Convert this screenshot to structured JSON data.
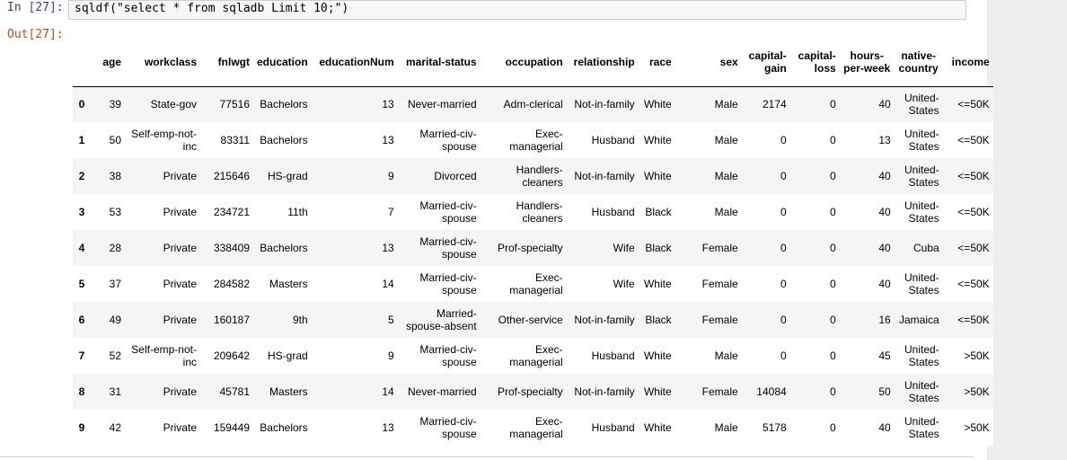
{
  "cell": {
    "in_prompt": "In [27]:",
    "code": "sqldf(\"select * from sqladb Limit 10;\")",
    "out_prompt": "Out[27]:"
  },
  "table": {
    "columns": [
      "",
      "age",
      "workclass",
      "fnlwgt",
      "education",
      "educationNum",
      "marital-status",
      "occupation",
      "relationship",
      "race",
      "sex",
      "capital-gain",
      "capital-loss",
      "hours-per-week",
      "native-country",
      "income"
    ],
    "rows": [
      [
        "0",
        "39",
        "State-gov",
        "77516",
        "Bachelors",
        "13",
        "Never-married",
        "Adm-clerical",
        "Not-in-family",
        "White",
        "Male",
        "2174",
        "0",
        "40",
        "United-States",
        "<=50K"
      ],
      [
        "1",
        "50",
        "Self-emp-not-inc",
        "83311",
        "Bachelors",
        "13",
        "Married-civ-spouse",
        "Exec-managerial",
        "Husband",
        "White",
        "Male",
        "0",
        "0",
        "13",
        "United-States",
        "<=50K"
      ],
      [
        "2",
        "38",
        "Private",
        "215646",
        "HS-grad",
        "9",
        "Divorced",
        "Handlers-cleaners",
        "Not-in-family",
        "White",
        "Male",
        "0",
        "0",
        "40",
        "United-States",
        "<=50K"
      ],
      [
        "3",
        "53",
        "Private",
        "234721",
        "11th",
        "7",
        "Married-civ-spouse",
        "Handlers-cleaners",
        "Husband",
        "Black",
        "Male",
        "0",
        "0",
        "40",
        "United-States",
        "<=50K"
      ],
      [
        "4",
        "28",
        "Private",
        "338409",
        "Bachelors",
        "13",
        "Married-civ-spouse",
        "Prof-specialty",
        "Wife",
        "Black",
        "Female",
        "0",
        "0",
        "40",
        "Cuba",
        "<=50K"
      ],
      [
        "5",
        "37",
        "Private",
        "284582",
        "Masters",
        "14",
        "Married-civ-spouse",
        "Exec-managerial",
        "Wife",
        "White",
        "Female",
        "0",
        "0",
        "40",
        "United-States",
        "<=50K"
      ],
      [
        "6",
        "49",
        "Private",
        "160187",
        "9th",
        "5",
        "Married-spouse-absent",
        "Other-service",
        "Not-in-family",
        "Black",
        "Female",
        "0",
        "0",
        "16",
        "Jamaica",
        "<=50K"
      ],
      [
        "7",
        "52",
        "Self-emp-not-inc",
        "209642",
        "HS-grad",
        "9",
        "Married-civ-spouse",
        "Exec-managerial",
        "Husband",
        "White",
        "Male",
        "0",
        "0",
        "45",
        "United-States",
        ">50K"
      ],
      [
        "8",
        "31",
        "Private",
        "45781",
        "Masters",
        "14",
        "Never-married",
        "Prof-specialty",
        "Not-in-family",
        "White",
        "Female",
        "14084",
        "0",
        "50",
        "United-States",
        ">50K"
      ],
      [
        "9",
        "42",
        "Private",
        "159449",
        "Bachelors",
        "13",
        "Married-civ-spouse",
        "Exec-managerial",
        "Husband",
        "White",
        "Male",
        "5178",
        "0",
        "40",
        "United-States",
        ">50K"
      ]
    ]
  },
  "colors": {
    "in_prompt": "#303f9f",
    "out_prompt": "#d84315",
    "stripe": "#f5f5f5"
  }
}
